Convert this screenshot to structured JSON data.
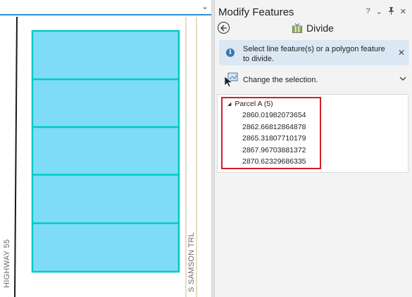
{
  "map": {
    "road_labels": {
      "highway": "HIGHWAY 55",
      "samson": "S SAMSON TRL"
    },
    "parcel_fill": "#7fdcf7",
    "parcel_stroke": "#00cbc4"
  },
  "pane": {
    "title": "Modify Features",
    "controls": {
      "help": "?",
      "menu": "⌄",
      "pin": "🖈",
      "close": "✕"
    },
    "tool": {
      "name": "Divide",
      "icon": "divide-tool-icon"
    },
    "info": {
      "message": "Select line feature(s) or a polygon feature to divide.",
      "close": "✕"
    },
    "selection": {
      "label": "Change the selection."
    },
    "tree": {
      "parent": "Parcel A (5)",
      "items": [
        "2860.01982073654",
        "2862.66812864878",
        "2865.31807710179",
        "2867.96703881372",
        "2870.62329686335"
      ]
    }
  },
  "colors": {
    "accent": "#2e8fd6",
    "highlight": "#d21f27",
    "info_bg": "#dbe8f4"
  }
}
